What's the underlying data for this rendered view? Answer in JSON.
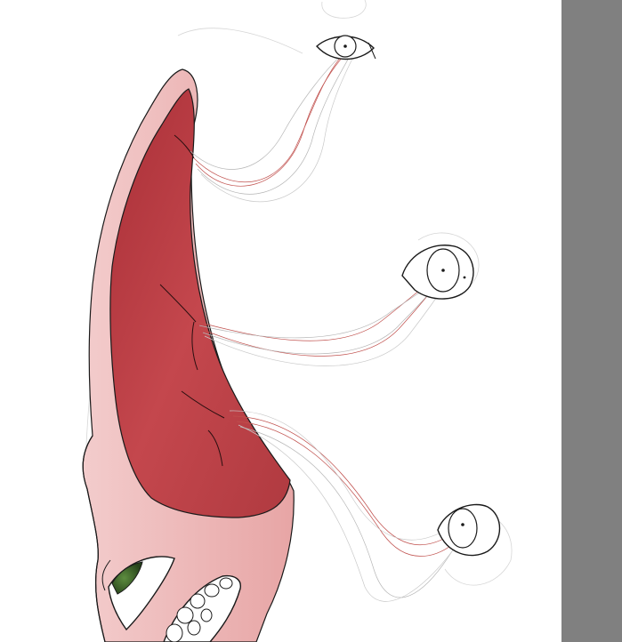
{
  "canvas": {
    "background": "#ffffff",
    "subject": "illustration-tongue-with-eyes"
  },
  "colors": {
    "tongue_dark": "#b7373e",
    "tongue_mid": "#c24a4f",
    "skin_light": "#f0c1c1",
    "skin_mid": "#e5a6a6",
    "eye_green": "#3d6b2c",
    "thread_red": "#c0504d",
    "thread_grey": "#b5b5b5",
    "line": "#1a1a1a",
    "side_panel": "#808080"
  },
  "icons": {
    "eye_top": "eye-icon",
    "eye_middle": "eye-icon",
    "eye_bottom": "eye-icon"
  }
}
